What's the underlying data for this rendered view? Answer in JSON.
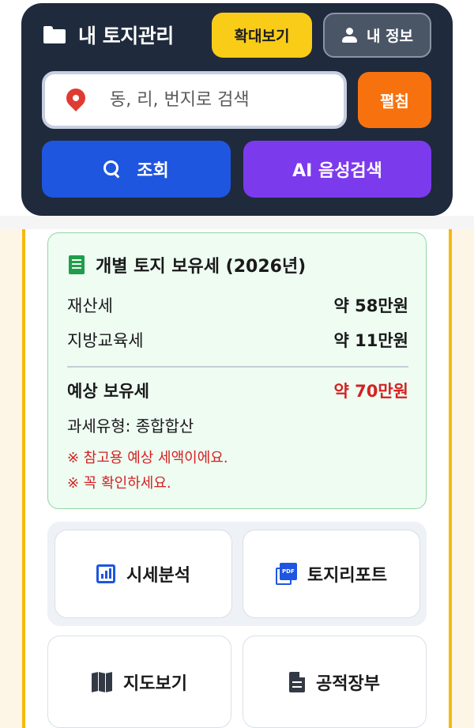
{
  "header": {
    "title": "내 토지관리",
    "zoom_label": "확대보기",
    "my_info_label": "내 정보",
    "search_placeholder": "동, 리, 번지로 검색",
    "unfold_label": "펼침",
    "query_label": "조회",
    "ai_label": "AI 음성검색"
  },
  "tax_card": {
    "title": "개별 토지 보유세 (2026년)",
    "rows": [
      {
        "label": "재산세",
        "value": "약 58만원"
      },
      {
        "label": "지방교육세",
        "value": "약 11만원"
      }
    ],
    "total_label": "예상 보유세",
    "total_value": "약 70만원",
    "tax_type": "과세유형: 종합합산",
    "notes": [
      "※ 참고용 예상 세액이에요.",
      "※ 꼭 확인하세요."
    ]
  },
  "actions": [
    {
      "label": "시세분석",
      "icon": "chart-icon"
    },
    {
      "label": "토지리포트",
      "icon": "pdf-icon"
    },
    {
      "label": "지도보기",
      "icon": "map-icon"
    },
    {
      "label": "공적장부",
      "icon": "document-icon"
    }
  ],
  "colors": {
    "header_bg": "#1f2a3c",
    "zoom_button": "#f9cc18",
    "unfold_button": "#f7720f",
    "query_button": "#1f56e0",
    "ai_button": "#7c3aed",
    "total_value": "#d32222",
    "panel_border": "#f5b90d"
  }
}
